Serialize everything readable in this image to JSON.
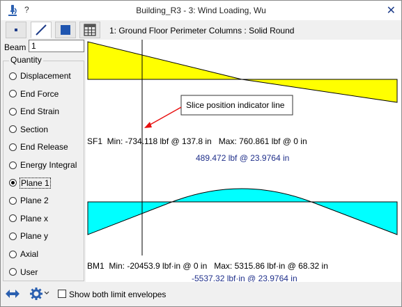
{
  "window": {
    "title": "Building_R3 - 3: Wind Loading, Wu"
  },
  "titlebar": {
    "help_label": "?",
    "close_label": "✕"
  },
  "toolbar": {
    "member_description": "1: Ground Floor Perimeter Columns : Solid Round",
    "buttons": [
      {
        "name": "node-view",
        "icon": "dot-icon"
      },
      {
        "name": "member-view",
        "icon": "line-icon",
        "active": true
      },
      {
        "name": "section-view",
        "icon": "square-icon"
      },
      {
        "name": "table-view",
        "icon": "table-icon"
      }
    ]
  },
  "beam": {
    "label": "Beam",
    "value": "1"
  },
  "quantity": {
    "title": "Quantity",
    "options": [
      {
        "label": "Displacement",
        "checked": false
      },
      {
        "label": "End Force",
        "checked": false
      },
      {
        "label": "End Strain",
        "checked": false
      },
      {
        "label": "Section",
        "checked": false
      },
      {
        "label": "End Release",
        "checked": false
      },
      {
        "label": "Energy Integral",
        "checked": false
      },
      {
        "label": "Plane 1",
        "checked": true
      },
      {
        "label": "Plane 2",
        "checked": false
      },
      {
        "label": "Plane x",
        "checked": false
      },
      {
        "label": "Plane y",
        "checked": false
      },
      {
        "label": "Axial",
        "checked": false
      },
      {
        "label": "User",
        "checked": false
      }
    ]
  },
  "annotation": {
    "text": "Slice position indicator line"
  },
  "colors": {
    "sf_fill": "#ffff00",
    "bm_fill": "#00ffff",
    "slice_value": "#1f2f8a",
    "arrow": "#e81010"
  },
  "chart_data": [
    {
      "type": "area",
      "series_label": "SF1",
      "x": [
        0,
        137.8
      ],
      "values": [
        760.861,
        -734.118
      ],
      "zero_crossing_x": 70.1,
      "summary": "SF1  Min: -734.118 lbf @ 137.8 in   Max: 760.861 lbf @ 0 in",
      "slice_value": "489.472 lbf @ 23.9764 in",
      "slice_x": 23.9764
    },
    {
      "type": "area",
      "series_label": "BM1",
      "x": [
        0,
        19.6,
        68.32,
        117.0,
        137.8
      ],
      "values": [
        -20453.9,
        0,
        5315.86,
        0,
        -20453.9
      ],
      "summary": "BM1  Min: -20453.9 lbf·in @ 0 in   Max: 5315.86 lbf·in @ 68.32 in",
      "slice_value": "-5537.32 lbf·in @ 23.9764 in",
      "slice_x": 23.9764
    }
  ],
  "bottom": {
    "show_both_label": "Show both limit envelopes",
    "show_both_checked": false
  }
}
